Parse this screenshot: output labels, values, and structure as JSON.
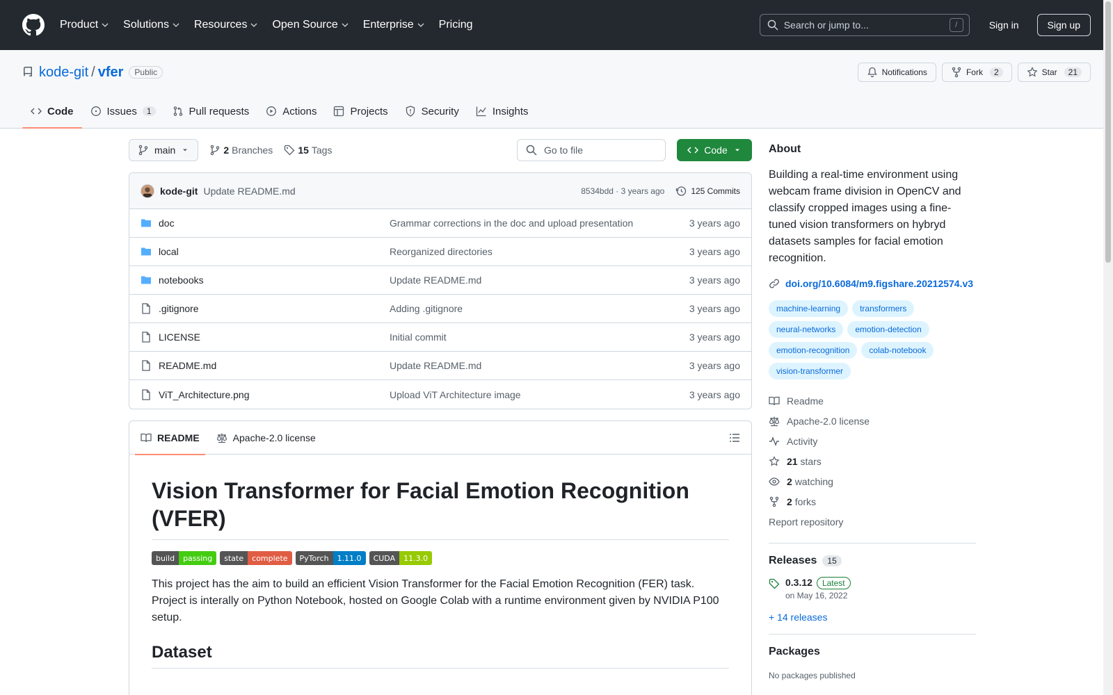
{
  "header": {
    "nav": [
      "Product",
      "Solutions",
      "Resources",
      "Open Source",
      "Enterprise",
      "Pricing"
    ],
    "search_placeholder": "Search or jump to...",
    "search_shortcut": "/",
    "signin": "Sign in",
    "signup": "Sign up"
  },
  "repo": {
    "owner": "kode-git",
    "separator": "/",
    "name": "vfer",
    "visibility": "Public",
    "notifications": "Notifications",
    "fork_label": "Fork",
    "fork_count": "2",
    "star_label": "Star",
    "star_count": "21"
  },
  "tabs": [
    {
      "label": "Code",
      "icon": "code-icon"
    },
    {
      "label": "Issues",
      "count": "1",
      "icon": "issue-icon"
    },
    {
      "label": "Pull requests",
      "icon": "pull-request-icon"
    },
    {
      "label": "Actions",
      "icon": "play-icon"
    },
    {
      "label": "Projects",
      "icon": "table-icon"
    },
    {
      "label": "Security",
      "icon": "shield-icon"
    },
    {
      "label": "Insights",
      "icon": "graph-icon"
    }
  ],
  "toolbar": {
    "branch": "main",
    "branches_count": "2",
    "branches_label": "Branches",
    "tags_count": "15",
    "tags_label": "Tags",
    "goto_placeholder": "Go to file",
    "code_button": "Code"
  },
  "commit": {
    "author": "kode-git",
    "message": "Update README.md",
    "meta": "8534bdd · 3 years ago",
    "count": "125 Commits"
  },
  "files": [
    {
      "name": "doc",
      "type": "folder",
      "message": "Grammar corrections in the doc and upload presentation",
      "age": "3 years ago"
    },
    {
      "name": "local",
      "type": "folder",
      "message": "Reorganized directories",
      "age": "3 years ago"
    },
    {
      "name": "notebooks",
      "type": "folder",
      "message": "Update README.md",
      "age": "3 years ago"
    },
    {
      "name": ".gitignore",
      "type": "file",
      "message": "Adding .gitignore",
      "age": "3 years ago"
    },
    {
      "name": "LICENSE",
      "type": "file",
      "message": "Initial commit",
      "age": "3 years ago"
    },
    {
      "name": "README.md",
      "type": "file",
      "message": "Update README.md",
      "age": "3 years ago"
    },
    {
      "name": "ViT_Architecture.png",
      "type": "file",
      "message": "Upload ViT Architecture image",
      "age": "3 years ago"
    }
  ],
  "readme": {
    "tab_readme": "README",
    "tab_license": "Apache-2.0 license",
    "title": "Vision Transformer for Facial Emotion Recognition (VFER)",
    "badges": [
      {
        "label": "build",
        "value": "passing",
        "color": "#4c1"
      },
      {
        "label": "state",
        "value": "complete",
        "color": "#e05d44"
      },
      {
        "label": "PyTorch",
        "value": "1.11.0",
        "color": "#007ec6"
      },
      {
        "label": "CUDA",
        "value": "11.3.0",
        "color": "#97ca00"
      }
    ],
    "intro": "This project has the aim to build an efficient Vision Transformer for the Facial Emotion Recognition (FER) task. Project is interally on Python Notebook, hosted on Google Colab with a runtime environment given by NVIDIA P100 setup.",
    "section_dataset": "Dataset"
  },
  "about": {
    "title": "About",
    "description": "Building a real-time environment using webcam frame division in OpenCV and classify cropped images using a fine-tuned vision transformers on hybryd datasets samples for facial emotion recognition.",
    "link": "doi.org/10.6084/m9.figshare.20212574.v3",
    "topics": [
      "machine-learning",
      "transformers",
      "neural-networks",
      "emotion-detection",
      "emotion-recognition",
      "colab-notebook",
      "vision-transformer"
    ],
    "readme": "Readme",
    "license": "Apache-2.0 license",
    "activity": "Activity",
    "stars_count": "21",
    "stars_label": "stars",
    "watching_count": "2",
    "watching_label": "watching",
    "forks_count": "2",
    "forks_label": "forks",
    "report": "Report repository"
  },
  "releases": {
    "title": "Releases",
    "count": "15",
    "latest_tag": "0.3.12",
    "latest_badge": "Latest",
    "latest_date": "on May 16, 2022",
    "more": "+ 14 releases"
  },
  "packages": {
    "title": "Packages",
    "note": "No packages published"
  },
  "colors": {
    "header_bg": "#24292f",
    "accent_link": "#0969da",
    "code_button": "#1f883d",
    "active_tab_underline": "#fd8c73"
  }
}
